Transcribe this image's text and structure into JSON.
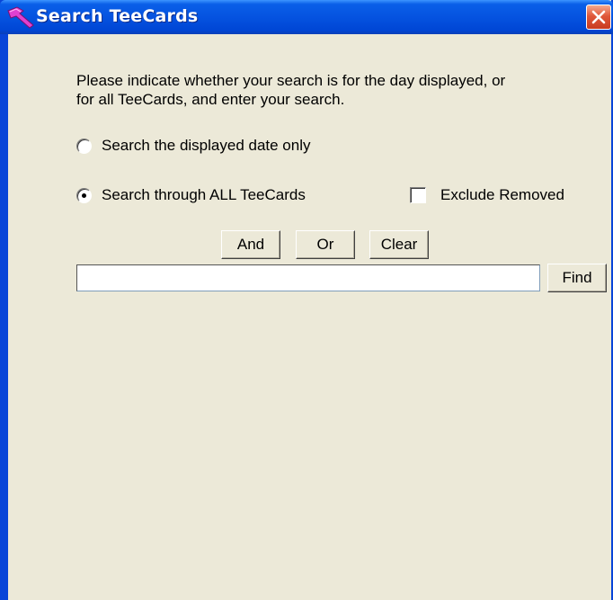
{
  "window": {
    "title": "Search TeeCards",
    "icon": "golf-tee-icon"
  },
  "instructions": "Please indicate whether your search is for the day displayed, or for all TeeCards, and enter your search.",
  "search_scope": {
    "options": [
      {
        "label": "Search the displayed date only",
        "checked": false
      },
      {
        "label": "Search through ALL TeeCards",
        "checked": true
      }
    ]
  },
  "exclude_removed": {
    "label": "Exclude Removed",
    "checked": false
  },
  "operators": {
    "and_label": "And",
    "or_label": "Or",
    "clear_label": "Clear"
  },
  "search": {
    "value": "",
    "placeholder": "",
    "find_label": "Find"
  },
  "colors": {
    "titlebar": "#0553e0",
    "dialog_face": "#ece9d8",
    "close_button": "#e0583a",
    "icon_accent": "#e040d0"
  }
}
